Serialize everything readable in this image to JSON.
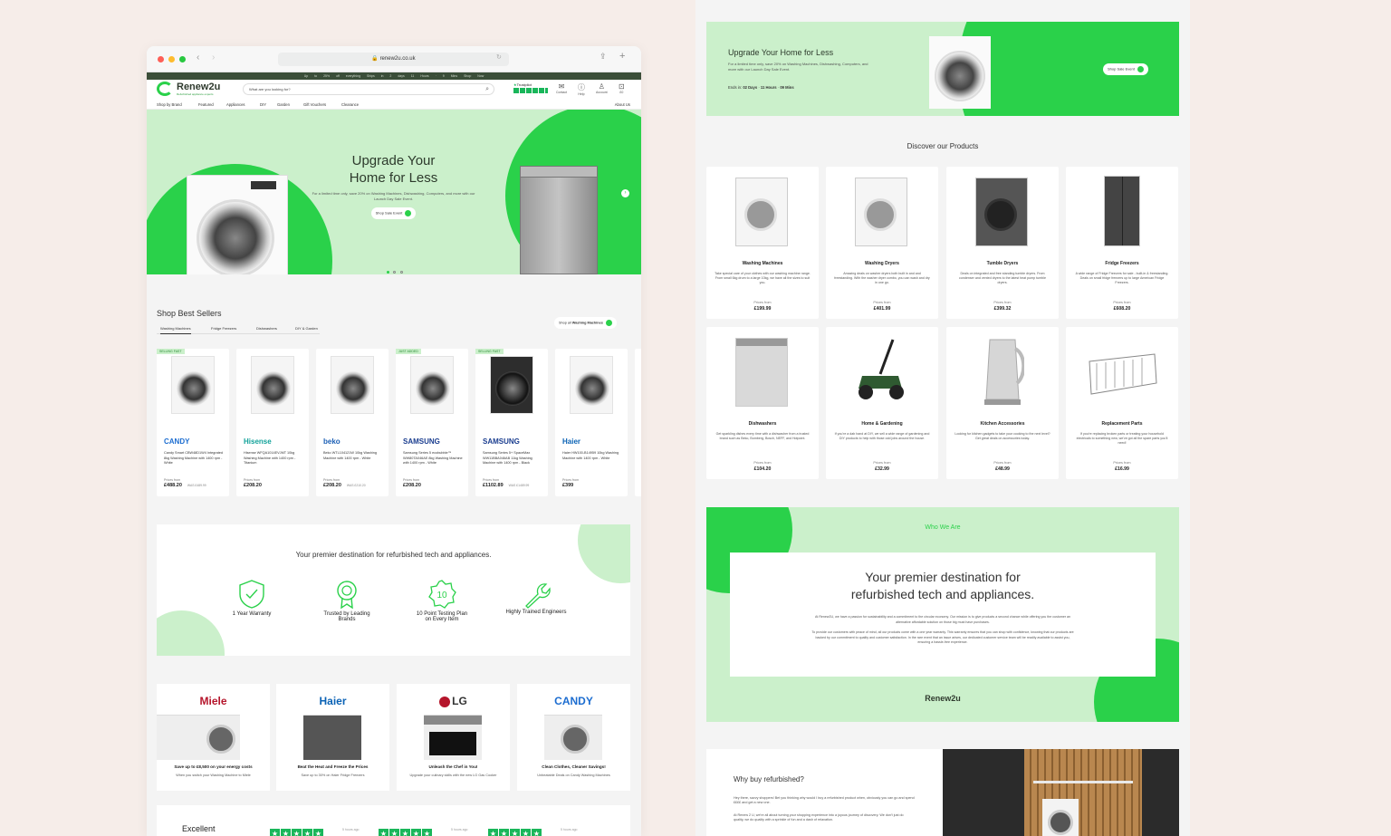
{
  "browser": {
    "url": "renew2u.co.uk"
  },
  "topbar": {
    "promo": "Up to 25% off everything",
    "info1": "Ships in 2 days",
    "info2": "11 Hours · 9 Mins",
    "cta": "Shop Now"
  },
  "header": {
    "logo": "Renew2u",
    "logo_tagline": "Refurbished appliance experts",
    "search_placeholder": "What are you looking for?",
    "trustpilot": "Trustpilot",
    "icons": {
      "contact": "Contact",
      "help": "Help",
      "account": "Account",
      "basket": "£0"
    }
  },
  "nav": {
    "items": [
      "Shop by Brand",
      "Featured",
      "Appliances",
      "DIY",
      "Garden",
      "Gift Vouchers",
      "Clearance"
    ],
    "about": "About Us"
  },
  "hero": {
    "title1": "Upgrade Your",
    "title2": "Home for Less",
    "subtitle": "For a limited time only, save 20% on Washing Machines, Dishwashing, Computers, and more with our Launch Day Sale Event.",
    "cta": "Shop Sale Event"
  },
  "best_sellers": {
    "title": "Shop Best Sellers",
    "tabs": [
      "Washing Machines",
      "Fridge Freezers",
      "Dishwashers",
      "DIY & Garden"
    ],
    "shop_all_prefix": "Shop all",
    "shop_all_bold": "Washing Machines",
    "products": [
      {
        "badge": "SELLING FAST",
        "brand": "CANDY",
        "desc": "Candy Smart CBW48D1W4 Integrated 8kg Washing Machine with 1400 rpm - White",
        "from": "Prices from",
        "price": "£488.20",
        "was": "WAS £489.99"
      },
      {
        "badge": "",
        "brand": "Hisense",
        "desc": "Hisense WFQA1014EVJMT 10kg Washing Machine with 1400 rpm - Titanium",
        "from": "Prices from",
        "price": "£208.20",
        "was": ""
      },
      {
        "badge": "",
        "brand": "beko",
        "desc": "Beko WTL104121W 10kg Washing Machine with 1400 rpm - White",
        "from": "Prices from",
        "price": "£208.20",
        "was": "WAS £210.20"
      },
      {
        "badge": "JUST ADDED",
        "brand": "SAMSUNG",
        "desc": "Samsung Series 5 ecobubble™ WW80TA046AE 8kg Washing Machine with 1400 rpm - White",
        "from": "Prices from",
        "price": "£208.20",
        "was": ""
      },
      {
        "badge": "SELLING FAST",
        "brand": "SAMSUNG",
        "desc": "Samsung Series 5+ SpaceMax WW11BBA046AB 11kg Washing Machine with 1400 rpm - Black",
        "from": "Prices from",
        "price": "£1102.89",
        "was": "WAS £1489.99"
      },
      {
        "badge": "",
        "brand": "Haier",
        "desc": "Haier HW100-B14959 10kg Washing Machine with 1400 rpm - White",
        "from": "Prices from",
        "price": "£399",
        "was": ""
      }
    ]
  },
  "usp": {
    "title": "Your premier destination for refurbished tech and appliances.",
    "items": [
      {
        "l1": "1 Year Warranty",
        "l2": ""
      },
      {
        "l1": "Trusted by Leading",
        "l2": "Brands"
      },
      {
        "l1": "10 Point Testing Plan",
        "l2": "on Every Item"
      },
      {
        "l1": "Highly Trained Engineers",
        "l2": ""
      }
    ],
    "badge_number": "10"
  },
  "brands": [
    {
      "name": "Miele",
      "title": "Save up to £8,500 on your energy costs",
      "sub": "When you switch your Washing Machine to Miele"
    },
    {
      "name": "Haier",
      "title": "Beat the Heat and Freeze the Prices",
      "sub": "Save up to 30% on Haier Fridge Freezers"
    },
    {
      "name": "LG",
      "title": "Unleash the Chef in You!",
      "sub": "Upgrade your culinary skills with the new LG Gas Cooker"
    },
    {
      "name": "CANDY",
      "title": "Clean Clothes, Cleaner Savings!",
      "sub": "Unbeatable Deals on Candy Washing Machines"
    }
  ],
  "reviews": {
    "rating": "Excellent",
    "ago": "5 hours ago"
  },
  "promo": {
    "title": "Upgrade Your Home for Less",
    "text": "For a limited time only, save 20% on Washing Machines, Dishwashing, Computers, and more with our Launch Day Sale Event.",
    "ends_label": "Ends in:",
    "days": "02 Days",
    "hours": "11 Hours",
    "mins": "09 Mins",
    "cta": "Shop Sale Event"
  },
  "discover": {
    "title": "Discover our Products",
    "from_label": "Prices from",
    "items": [
      {
        "name": "Washing Machines",
        "desc": "Take special care of your clothes with our washing machine range. From small 6kg drum to a large 10kg, we have all the sizes to suit you.",
        "price": "£199.99"
      },
      {
        "name": "Washing Dryers",
        "desc": "Amazing deals on washer dryers both built in and and freestanding. With the washer dryer combo, you can wash and dry in one go.",
        "price": "£401.99"
      },
      {
        "name": "Tumble Dryers",
        "desc": "Deals on integrated and free standing tumble dryers. From condenser and vented dryers to the latest heat pump tumble dryers.",
        "price": "£399.32"
      },
      {
        "name": "Fridge Freezers",
        "desc": "A wide range of Fridge Freezers for sale - built-in & freestanding. Deals on small fridge freezers up to large American Fridge Freezers.",
        "price": "£608.20"
      },
      {
        "name": "Dishwashers",
        "desc": "Get sparkling dishes every time with a dishwasher from a trusted brand such as Beko, Bomberg, Bosch, NEFF, and Hotpoint.",
        "price": "£104.20"
      },
      {
        "name": "Home & Gardening",
        "desc": "If you're a dab hand at DIY, we sell a wide range of gardening and DIY products to help with those odd jobs around the house.",
        "price": "£32.99"
      },
      {
        "name": "Kitchen Accessories",
        "desc": "Looking for kitchen gadgets to take your cooking to the next level? Get great deals on accessories today.",
        "price": "£48.99"
      },
      {
        "name": "Replacement Parts",
        "desc": "If you're replacing broken parts or treating your household electricals to something new, we've got all the spare parts you'll need!",
        "price": "£16.99"
      }
    ]
  },
  "who": {
    "label": "Who We Are",
    "title1": "Your premier destination for",
    "title2": "refurbished tech and appliances.",
    "p1": "At Renew2U, we have a passion for sustainability and a commitment to the circular economy. Our mission is to give products a second chance while offering you the customer an alternative affordable solution on those big must have purchases.",
    "p2": "To provide our customers with peace of mind, all our products come with a one year warranty. This warranty ensures that you can shop with confidence, knowing that our products are backed by our commitment to quality and customer satisfaction. In the rare event that an issue arises, our dedicated customer service team will be readily available to assist you, ensuring a hassle-free experience.",
    "logo": "Renew2u"
  },
  "why": {
    "title": "Why buy refurbished?",
    "p1": "Hey there, savvy shoppers! Bet you thinking why would I buy a refurbished product when, obviously you can go and spend ££££ and get a new one.",
    "p2": "At Renew 2 U, we're all about turning your shopping experience into a joyous journey of discovery. We don't just do quality, we do quality with a sprinkle of fun and a dash of relaxation."
  },
  "colors": {
    "brand_green": "#2ad14a",
    "mint": "#cbf0cb",
    "dark_bar": "#3b4e39"
  }
}
